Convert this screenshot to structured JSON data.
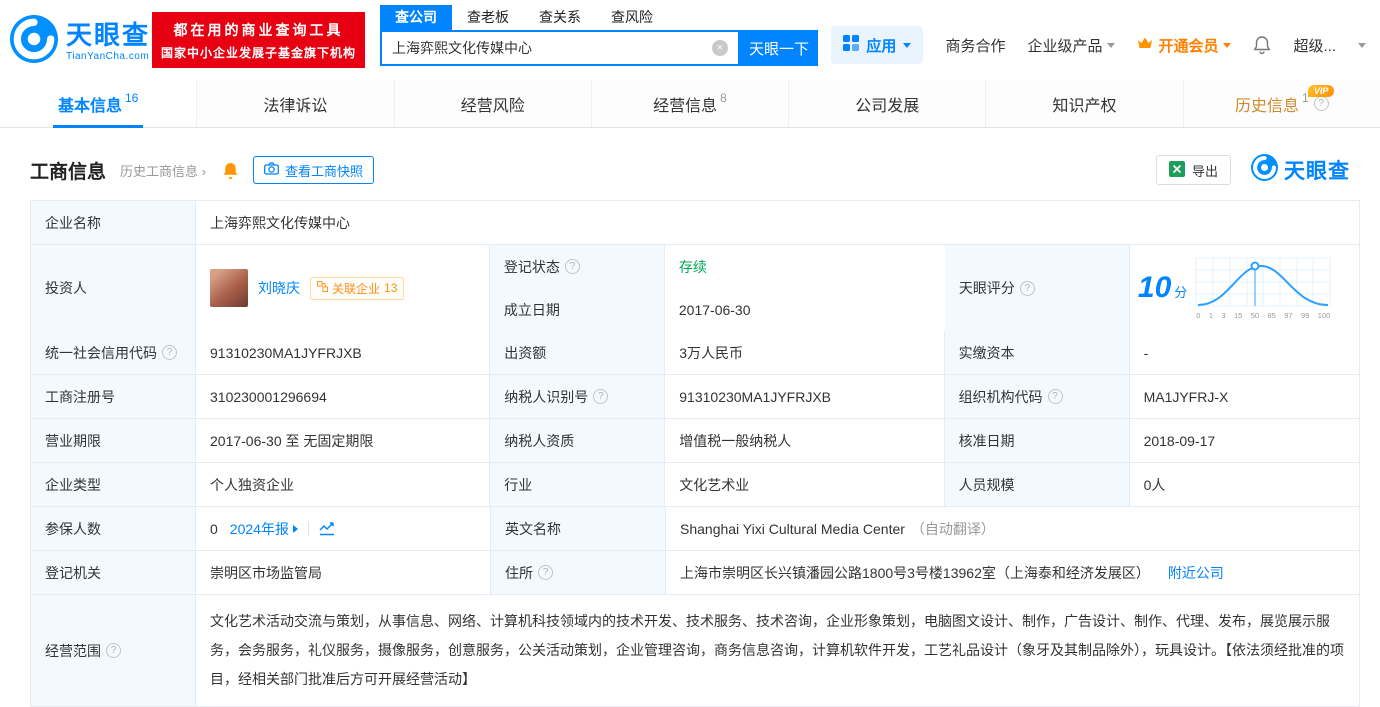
{
  "colors": {
    "accent": "#0084ff",
    "status_green": "#00a854",
    "member_orange": "#ff8000",
    "promo_red": "#e60012"
  },
  "header": {
    "logo_title": "天眼查",
    "logo_domain": "TianYanCha.com",
    "promo_line1": "都在用的商业查询工具",
    "promo_line2": "国家中小企业发展子基金旗下机构",
    "search_tabs": [
      {
        "label": "查公司"
      },
      {
        "label": "查老板"
      },
      {
        "label": "查关系"
      },
      {
        "label": "查风险"
      }
    ],
    "search_value": "上海弈熙文化传媒中心",
    "search_button": "天眼一下",
    "app_label": "应用",
    "biz_coop": "商务合作",
    "enterprise_product": "企业级产品",
    "member": "开通会员",
    "super_label": "超级..."
  },
  "tabs": [
    {
      "label": "基本信息",
      "count": "16"
    },
    {
      "label": "法律诉讼"
    },
    {
      "label": "经营风险"
    },
    {
      "label": "经营信息",
      "count": "8"
    },
    {
      "label": "公司发展"
    },
    {
      "label": "知识产权"
    },
    {
      "label": "历史信息",
      "count": "1",
      "vip": "VIP"
    }
  ],
  "section": {
    "title": "工商信息",
    "history": "历史工商信息",
    "snapshot": "查看工商快照",
    "export": "导出",
    "brand": "天眼查"
  },
  "info": {
    "company_name": {
      "label": "企业名称",
      "value": "上海弈熙文化传媒中心"
    },
    "investor": {
      "label": "投资人",
      "name": "刘晓庆",
      "related_label": "关联企业",
      "related_count": "13"
    },
    "reg_status": {
      "label": "登记状态",
      "value": "存续"
    },
    "establish_date": {
      "label": "成立日期",
      "value": "2017-06-30"
    },
    "score": {
      "label": "天眼评分",
      "value": "10",
      "unit": "分",
      "ticks": [
        "0",
        "1",
        "3",
        "15",
        "50",
        "85",
        "97",
        "99",
        "100"
      ]
    },
    "credit_code": {
      "label": "统一社会信用代码",
      "value": "91310230MA1JYFRJXB"
    },
    "capital": {
      "label": "出资额",
      "value": "3万人民币"
    },
    "paid_capital": {
      "label": "实缴资本",
      "value": "-"
    },
    "reg_no": {
      "label": "工商注册号",
      "value": "310230001296694"
    },
    "tax_id": {
      "label": "纳税人识别号",
      "value": "91310230MA1JYFRJXB"
    },
    "org_code": {
      "label": "组织机构代码",
      "value": "MA1JYFRJ-X"
    },
    "term": {
      "label": "营业期限",
      "value": "2017-06-30 至 无固定期限"
    },
    "tax_quality": {
      "label": "纳税人资质",
      "value": "增值税一般纳税人"
    },
    "approve_date": {
      "label": "核准日期",
      "value": "2018-09-17"
    },
    "company_type": {
      "label": "企业类型",
      "value": "个人独资企业"
    },
    "industry": {
      "label": "行业",
      "value": "文化艺术业"
    },
    "staff": {
      "label": "人员规模",
      "value": "0人"
    },
    "insured": {
      "label": "参保人数",
      "value": "0",
      "report": "2024年报"
    },
    "english_name": {
      "label": "英文名称",
      "value": "Shanghai Yixi Cultural Media Center",
      "note": "（自动翻译）"
    },
    "authority": {
      "label": "登记机关",
      "value": "崇明区市场监管局"
    },
    "address": {
      "label": "住所",
      "value": "上海市崇明区长兴镇潘园公路1800号3号楼13962室（上海泰和经济发展区）",
      "nearby": "附近公司"
    },
    "scope": {
      "label": "经营范围",
      "value": "文化艺术活动交流与策划，从事信息、网络、计算机科技领域内的技术开发、技术服务、技术咨询，企业形象策划，电脑图文设计、制作，广告设计、制作、代理、发布，展览展示服务，会务服务，礼仪服务，摄像服务，创意服务，公关活动策划，企业管理咨询，商务信息咨询，计算机软件开发，工艺礼品设计（象牙及其制品除外），玩具设计。【依法须经批准的项目，经相关部门批准后方可开展经营活动】"
    }
  }
}
